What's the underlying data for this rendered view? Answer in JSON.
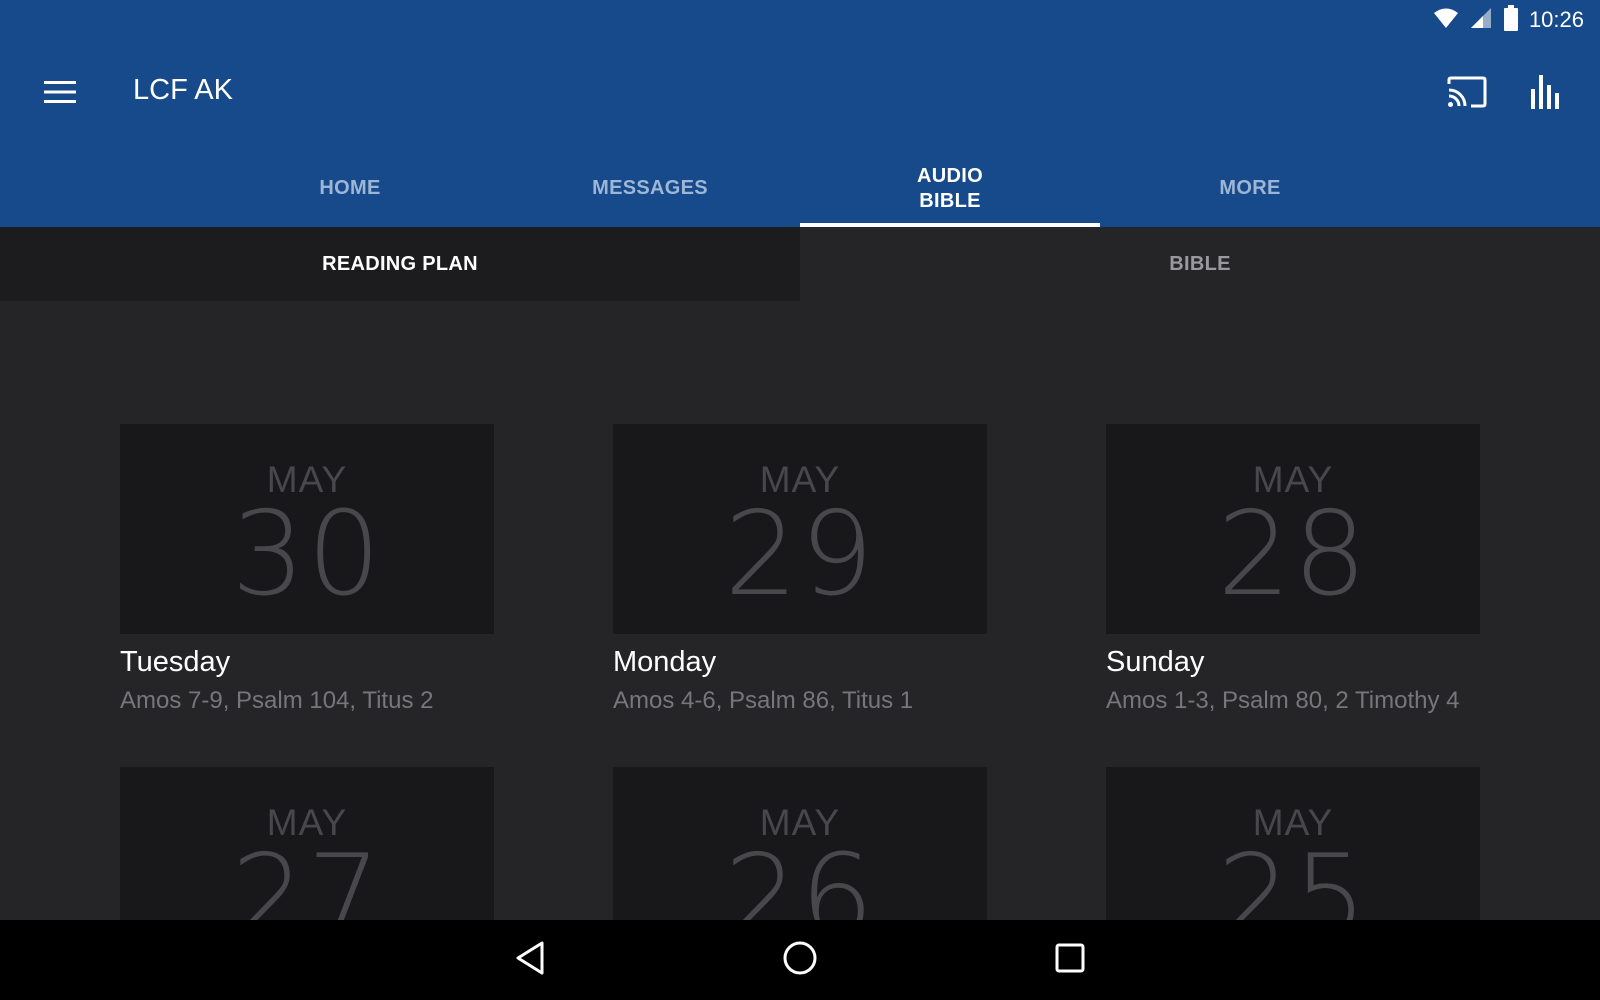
{
  "status_bar": {
    "time": "10:26",
    "icons": [
      "wifi-icon",
      "cell-signal-icon",
      "battery-icon"
    ]
  },
  "toolbar": {
    "title": "LCF AK",
    "icons": [
      "menu-icon",
      "cast-icon",
      "equalizer-icon"
    ]
  },
  "tabs": [
    {
      "label": "HOME",
      "active": false
    },
    {
      "label": "MESSAGES",
      "active": false
    },
    {
      "label": "AUDIO BIBLE",
      "active": true
    },
    {
      "label": "MORE",
      "active": false
    }
  ],
  "subtabs": [
    {
      "label": "READING PLAN",
      "active": true
    },
    {
      "label": "BIBLE",
      "active": false
    }
  ],
  "readings": [
    {
      "month": "MAY",
      "day": "30",
      "weekday": "Tuesday",
      "passages": "Amos 7-9, Psalm 104, Titus 2"
    },
    {
      "month": "MAY",
      "day": "29",
      "weekday": "Monday",
      "passages": "Amos 4-6, Psalm 86, Titus 1"
    },
    {
      "month": "MAY",
      "day": "28",
      "weekday": "Sunday",
      "passages": "Amos 1-3, Psalm 80, 2 Timothy 4"
    },
    {
      "month": "MAY",
      "day": "27",
      "weekday": "",
      "passages": ""
    },
    {
      "month": "MAY",
      "day": "26",
      "weekday": "",
      "passages": ""
    },
    {
      "month": "MAY",
      "day": "25",
      "weekday": "",
      "passages": ""
    }
  ],
  "nav_bar": {
    "icons": [
      "back-icon",
      "home-icon",
      "recents-icon"
    ]
  },
  "colors": {
    "app_bar": "#174a8b",
    "background": "#252527",
    "card": "#18181a",
    "nav_bar": "#000000"
  }
}
